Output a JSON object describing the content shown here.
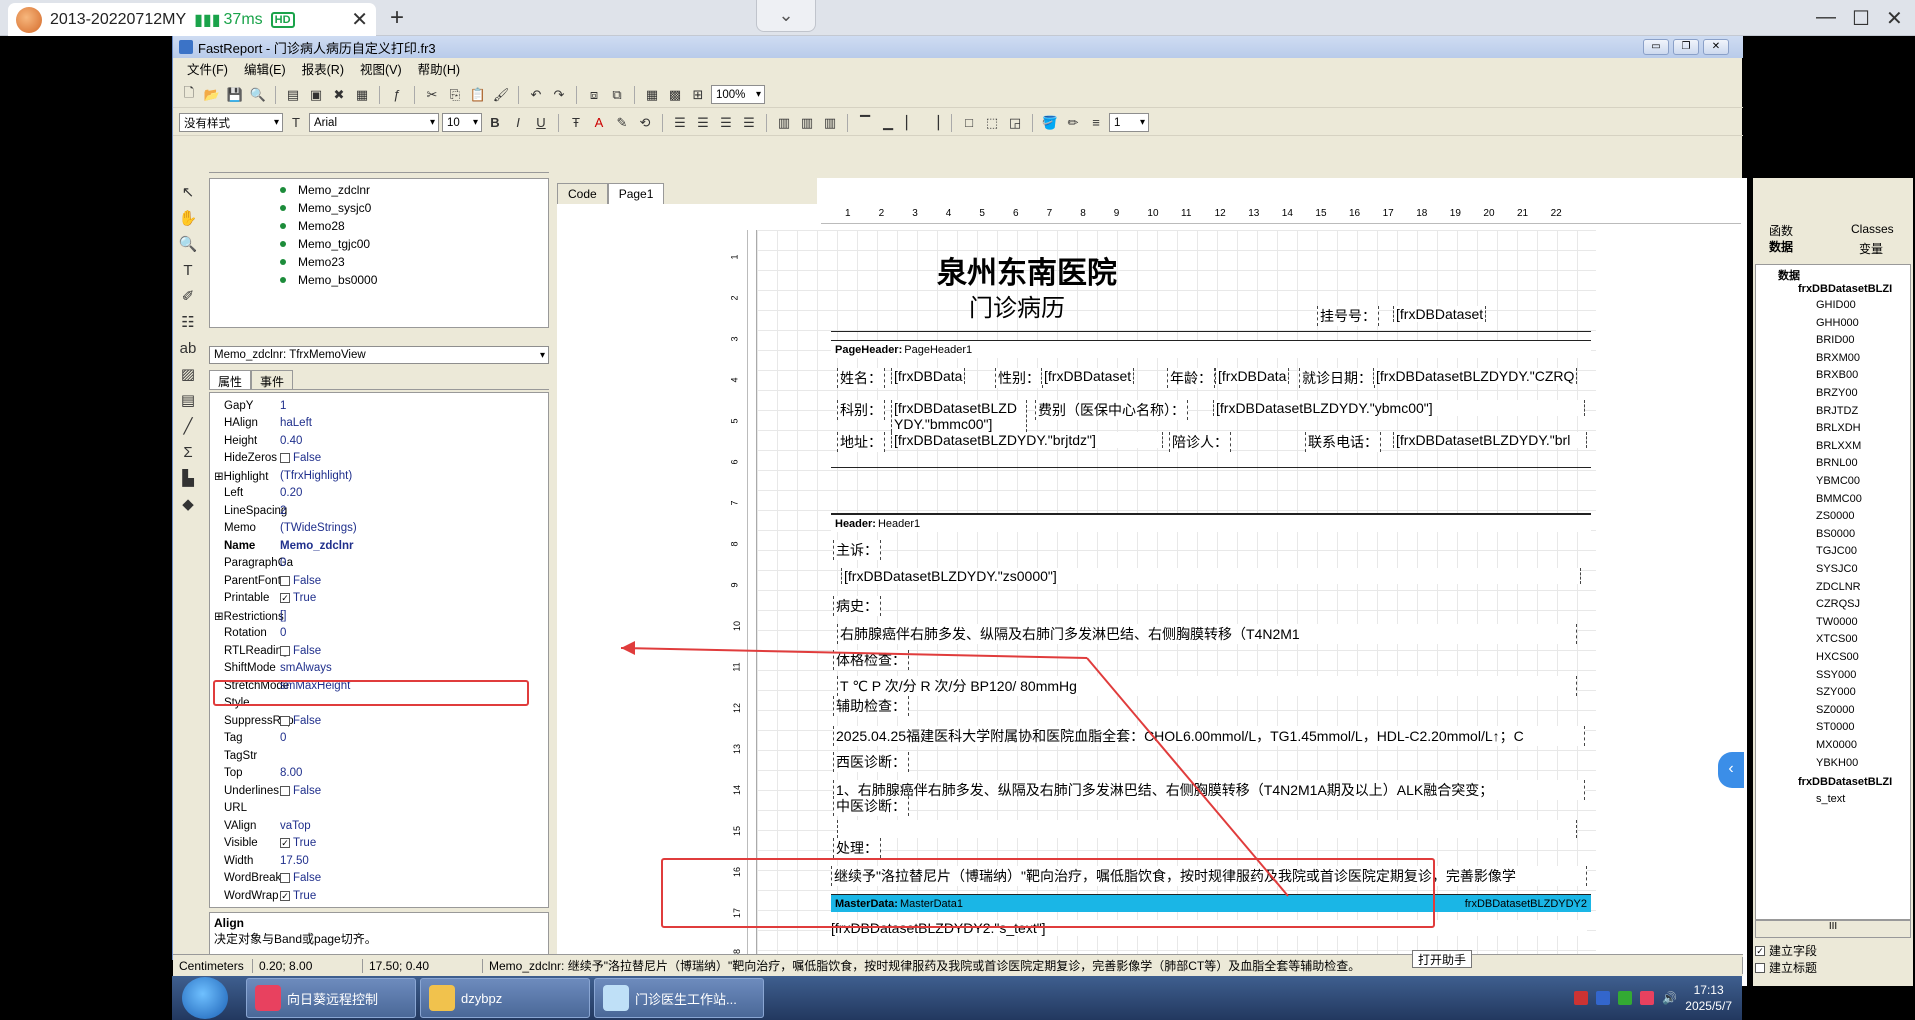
{
  "browser": {
    "tab_title": "2013-20220712MY",
    "latency": "37ms",
    "quality": "HD",
    "close": "✕",
    "new_tab": "+",
    "min": "—",
    "max": "☐",
    "close_win": "✕",
    "collapse": "⌄"
  },
  "window": {
    "title": "FastReport - 门诊病人病历自定义打印.fr3",
    "menu": [
      "文件(F)",
      "编辑(E)",
      "报表(R)",
      "视图(V)",
      "帮助(H)"
    ],
    "zoom": "100%",
    "style_combo": "没有样式",
    "font_combo": "Arial",
    "size_combo": "10",
    "frame_width_combo": "1",
    "tb_min": "▭",
    "tb_max": "❐",
    "tb_close": "✕"
  },
  "tree": {
    "items": [
      "Memo_zdclnr",
      "Memo_sysjc0",
      "Memo28",
      "Memo_tgjc00",
      "Memo23",
      "Memo_bs0000"
    ]
  },
  "object_combo": "Memo_zdclnr: TfrxMemoView",
  "prop_tabs": [
    "属性",
    "事件"
  ],
  "properties": [
    {
      "n": "GapY",
      "v": "1"
    },
    {
      "n": "HAlign",
      "v": "haLeft"
    },
    {
      "n": "Height",
      "v": "0.40"
    },
    {
      "n": "HideZeros",
      "v": "False",
      "cb": "0"
    },
    {
      "n": "Highlight",
      "v": "(TfrxHighlight)",
      "ex": "1"
    },
    {
      "n": "Left",
      "v": "0.20"
    },
    {
      "n": "LineSpacing",
      "v": "2"
    },
    {
      "n": "Memo",
      "v": "(TWideStrings)"
    },
    {
      "n": "Name",
      "v": "Memo_zdclnr",
      "bold": "1"
    },
    {
      "n": "ParagraphGa",
      "v": "0"
    },
    {
      "n": "ParentFont",
      "v": "False",
      "cb": "0"
    },
    {
      "n": "Printable",
      "v": "True",
      "cb": "1"
    },
    {
      "n": "Restrictions",
      "v": "[]",
      "ex": "1"
    },
    {
      "n": "Rotation",
      "v": "0"
    },
    {
      "n": "RTLReading",
      "v": "False",
      "cb": "0"
    },
    {
      "n": "ShiftMode",
      "v": "smAlways"
    },
    {
      "n": "StretchMode",
      "v": "smMaxHeight"
    },
    {
      "n": "Style",
      "v": ""
    },
    {
      "n": "SuppressRep",
      "v": "False",
      "cb": "0"
    },
    {
      "n": "Tag",
      "v": "0"
    },
    {
      "n": "TagStr",
      "v": ""
    },
    {
      "n": "Top",
      "v": "8.00"
    },
    {
      "n": "Underlines",
      "v": "False",
      "cb": "0"
    },
    {
      "n": "URL",
      "v": ""
    },
    {
      "n": "VAlign",
      "v": "vaTop"
    },
    {
      "n": "Visible",
      "v": "True",
      "cb": "1"
    },
    {
      "n": "Width",
      "v": "17.50"
    },
    {
      "n": "WordBreak",
      "v": "False",
      "cb": "0"
    },
    {
      "n": "WordWrap",
      "v": "True",
      "cb": "1"
    }
  ],
  "desc": {
    "title": "Align",
    "text": "决定对象与Band或page切齐。"
  },
  "tabs": [
    "Code",
    "Page1"
  ],
  "ruler_h": [
    "1",
    "2",
    "3",
    "4",
    "5",
    "6",
    "7",
    "8",
    "9",
    "10",
    "11",
    "12",
    "13",
    "14",
    "15",
    "16",
    "17",
    "18",
    "19",
    "20",
    "21",
    "22"
  ],
  "ruler_v": [
    "1",
    "2",
    "3",
    "4",
    "5",
    "6",
    "7",
    "8",
    "9",
    "10",
    "11",
    "12",
    "13",
    "14",
    "15",
    "16",
    "17",
    "18"
  ],
  "report": {
    "hospital": "泉州东南医院",
    "subtitle": "门诊病历",
    "reg_label": "挂号号：",
    "reg_value": "[frxDBDataset",
    "page_header": {
      "kind": "PageHeader:",
      "name": "PageHeader1"
    },
    "ph_fields": [
      "姓名：",
      "[frxDBData",
      "性别：",
      "[frxDBDataset",
      "年龄：",
      "[frxDBData",
      "就诊日期：",
      "[frxDBDatasetBLZDYDY.\"CZRQ",
      "科别：",
      "[frxDBDatasetBLZD",
      "YDY.\"bmmc00\"]",
      "费别（医保中心名称）：",
      "[frxDBDatasetBLZDYDY.\"ybmc00\"]",
      "地址：",
      "[frxDBDatasetBLZDYDY.\"brjtdz\"]",
      "陪诊人：",
      "联系电话：",
      "[frxDBDatasetBLZDYDY.\"brl"
    ],
    "header": {
      "kind": "Header:",
      "name": "Header1"
    },
    "h_lines": [
      "主诉：",
      "[frxDBDatasetBLZDYDY.\"zs0000\"]",
      "病史：",
      "右肺腺癌伴右肺多发、纵隔及右肺门多发淋巴结、右侧胸膜转移（T4N2M1",
      "体格检查：",
      "T  ℃ P  次/分 R  次/分 BP120/ 80mmHg",
      "辅助检查：",
      "2025.04.25福建医科大学附属协和医院血脂全套：CHOL6.00mmol/L，TG1.45mmol/L，HDL-C2.20mmol/L↑；C",
      "西医诊断：",
      "1、右肺腺癌伴右肺多发、纵隔及右肺门多发淋巴结、右侧胸膜转移（T4N2M1A期及以上）ALK融合突变；",
      "中医诊断：",
      "",
      "处理：",
      "继续予\"洛拉替尼片（博瑞纳）\"靶向治疗，嘱低脂饮食，按时规律服药及我院或首诊医院定期复诊，完善影像学"
    ],
    "master": {
      "kind": "MasterData:",
      "name": "MasterData1",
      "ds": "frxDBDatasetBLZDYDY2"
    },
    "master_memo": "[frxDBDatasetBLZDYDY2.\"s_text\"]"
  },
  "right": {
    "tab1": "函数",
    "tab2": "Classes",
    "tab3": "数据",
    "tab4": "变量",
    "root": "数据",
    "ds1": "frxDBDatasetBLZI",
    "fields": [
      "GHID00",
      "GHH000",
      "BRID00",
      "BRXM00",
      "BRXB00",
      "BRZY00",
      "BRJTDZ",
      "BRLXDH",
      "BRLXXM",
      "BRNL00",
      "YBMC00",
      "BMMC00",
      "ZS0000",
      "BS0000",
      "TGJC00",
      "SYSJC0",
      "ZDCLNR",
      "CZRQSJ",
      "TW0000",
      "XTCS00",
      "HXCS00",
      "SSY000",
      "SZY000",
      "SZ0000",
      "ST0000",
      "MX0000",
      "YBKH00"
    ],
    "ds2": "frxDBDatasetBLZI",
    "ds2_field": "s_text",
    "chk1": "建立字段",
    "chk2": "建立标题",
    "scroll_mid": "III"
  },
  "status": {
    "units": "Centimeters",
    "pos": "0.20; 8.00",
    "size": "17.50; 0.40",
    "text": "Memo_zdclnr: 继续予\"洛拉替尼片（博瑞纳）\"靶向治疗，嘱低脂饮食，按时规律服药及我院或首诊医院定期复诊，完善影像学（肺部CT等）及血脂全套等辅助检查。",
    "helper": "打开助手"
  },
  "taskbar": {
    "tasks": [
      "向日葵远程控制",
      "dzybpz",
      "门诊医生工作站..."
    ],
    "time": "17:13",
    "date": "2025/5/7"
  }
}
